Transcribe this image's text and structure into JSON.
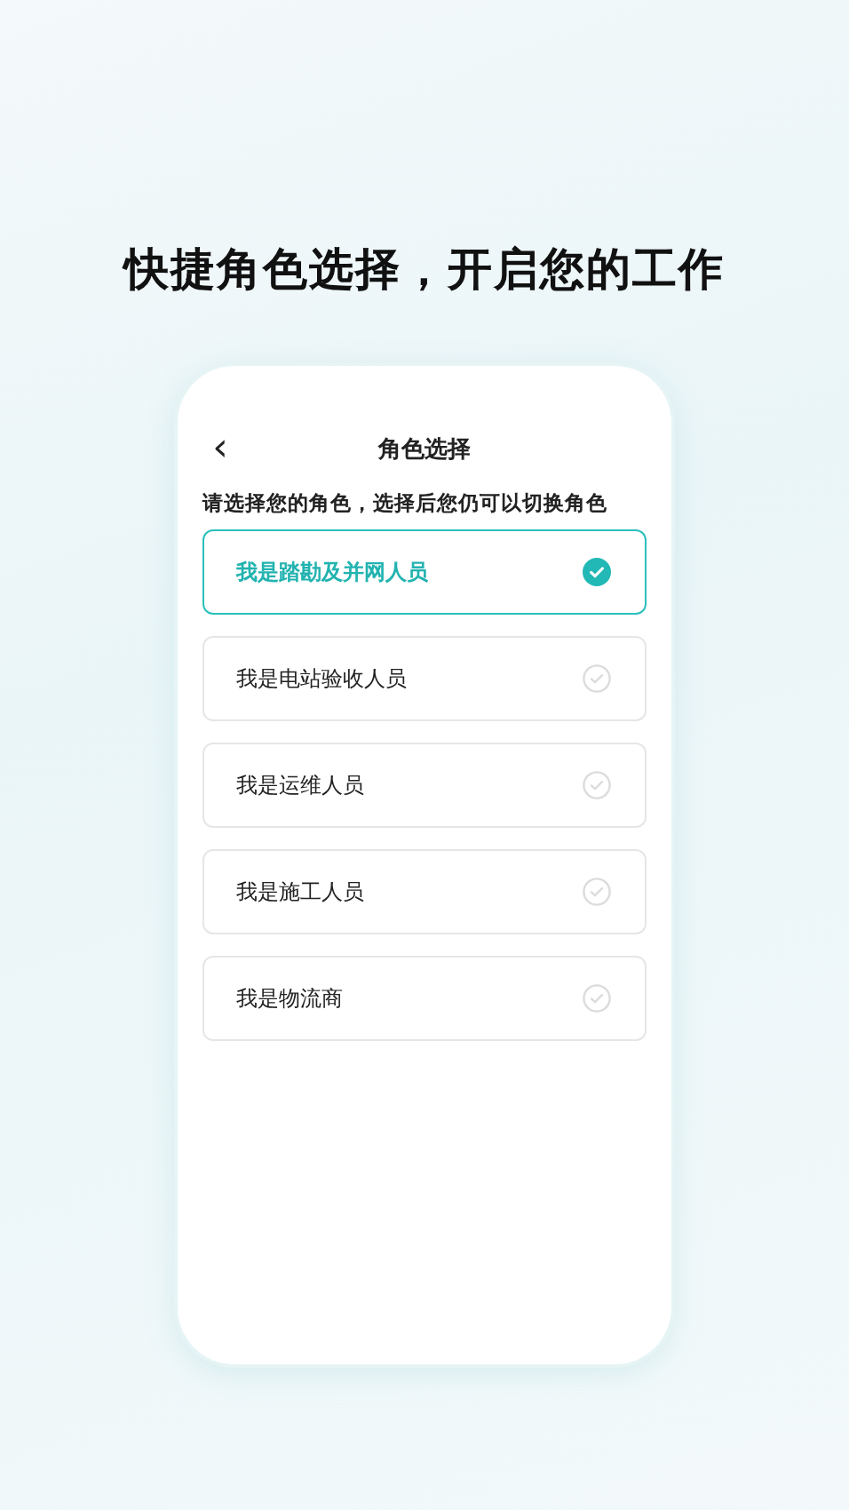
{
  "headline": "快捷角色选择，开启您的工作",
  "screen": {
    "back_icon": "‹",
    "title": "角色选择",
    "prompt": "请选择您的角色，选择后您仍可以切换角色",
    "roles": [
      {
        "label": "我是踏勘及并网人员",
        "selected": true
      },
      {
        "label": "我是电站验收人员",
        "selected": false
      },
      {
        "label": "我是运维人员",
        "selected": false
      },
      {
        "label": "我是施工人员",
        "selected": false
      },
      {
        "label": "我是物流商",
        "selected": false
      }
    ]
  }
}
